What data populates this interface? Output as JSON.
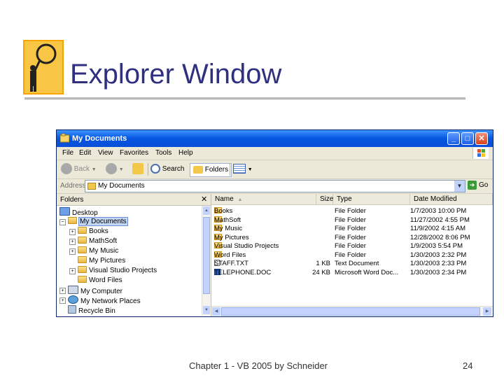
{
  "slide": {
    "title": "Explorer Window",
    "footer": "Chapter 1 - VB 2005 by Schneider",
    "page_number": "24"
  },
  "window": {
    "title": "My Documents",
    "menu": [
      "File",
      "Edit",
      "View",
      "Favorites",
      "Tools",
      "Help"
    ],
    "toolbar": {
      "back": "Back",
      "search": "Search",
      "folders": "Folders"
    },
    "address": {
      "label": "Address",
      "value": "My Documents",
      "go": "Go"
    },
    "folders_pane": {
      "title": "Folders",
      "items": [
        {
          "label": "Desktop",
          "icon": "desktop-icon"
        },
        {
          "label": "My Documents",
          "icon": "my-documents-icon",
          "expander": "−",
          "selected": true
        },
        {
          "label": "Books",
          "icon": "folder-icon",
          "expander": "+"
        },
        {
          "label": "MathSoft",
          "icon": "folder-icon",
          "expander": "+"
        },
        {
          "label": "My Music",
          "icon": "music-folder-icon",
          "expander": "+"
        },
        {
          "label": "My Pictures",
          "icon": "pictures-folder-icon"
        },
        {
          "label": "Visual Studio Projects",
          "icon": "folder-icon",
          "expander": "+"
        },
        {
          "label": "Word Files",
          "icon": "folder-icon"
        },
        {
          "label": "My Computer",
          "icon": "computer-icon",
          "expander": "+"
        },
        {
          "label": "My Network Places",
          "icon": "network-icon",
          "expander": "+"
        },
        {
          "label": "Recycle Bin",
          "icon": "recycle-bin-icon"
        }
      ]
    },
    "list": {
      "columns": [
        "Name",
        "Size",
        "Type",
        "Date Modified"
      ],
      "rows": [
        {
          "name": "Books",
          "size": "",
          "type": "File Folder",
          "date": "1/7/2003 10:00 PM",
          "icon": "folder-icon"
        },
        {
          "name": "MathSoft",
          "size": "",
          "type": "File Folder",
          "date": "11/27/2002 4:55 PM",
          "icon": "folder-icon"
        },
        {
          "name": "My Music",
          "size": "",
          "type": "File Folder",
          "date": "11/9/2002 4:15 AM",
          "icon": "music-folder-icon"
        },
        {
          "name": "My Pictures",
          "size": "",
          "type": "File Folder",
          "date": "12/28/2002 8:06 PM",
          "icon": "pictures-folder-icon"
        },
        {
          "name": "Visual Studio Projects",
          "size": "",
          "type": "File Folder",
          "date": "1/9/2003 5:54 PM",
          "icon": "folder-icon"
        },
        {
          "name": "Word Files",
          "size": "",
          "type": "File Folder",
          "date": "1/30/2003 2:32 PM",
          "icon": "folder-icon"
        },
        {
          "name": "STAFF.TXT",
          "size": "1 KB",
          "type": "Text Document",
          "date": "1/30/2003 2:33 PM",
          "icon": "text-file-icon"
        },
        {
          "name": "TELEPHONE.DOC",
          "size": "24 KB",
          "type": "Microsoft Word Doc...",
          "date": "1/30/2003 2:34 PM",
          "icon": "word-doc-icon"
        }
      ]
    }
  },
  "colors": {
    "title": "#2f3180",
    "titlebar": "#0a5be4",
    "window_bg": "#ece9d8"
  }
}
